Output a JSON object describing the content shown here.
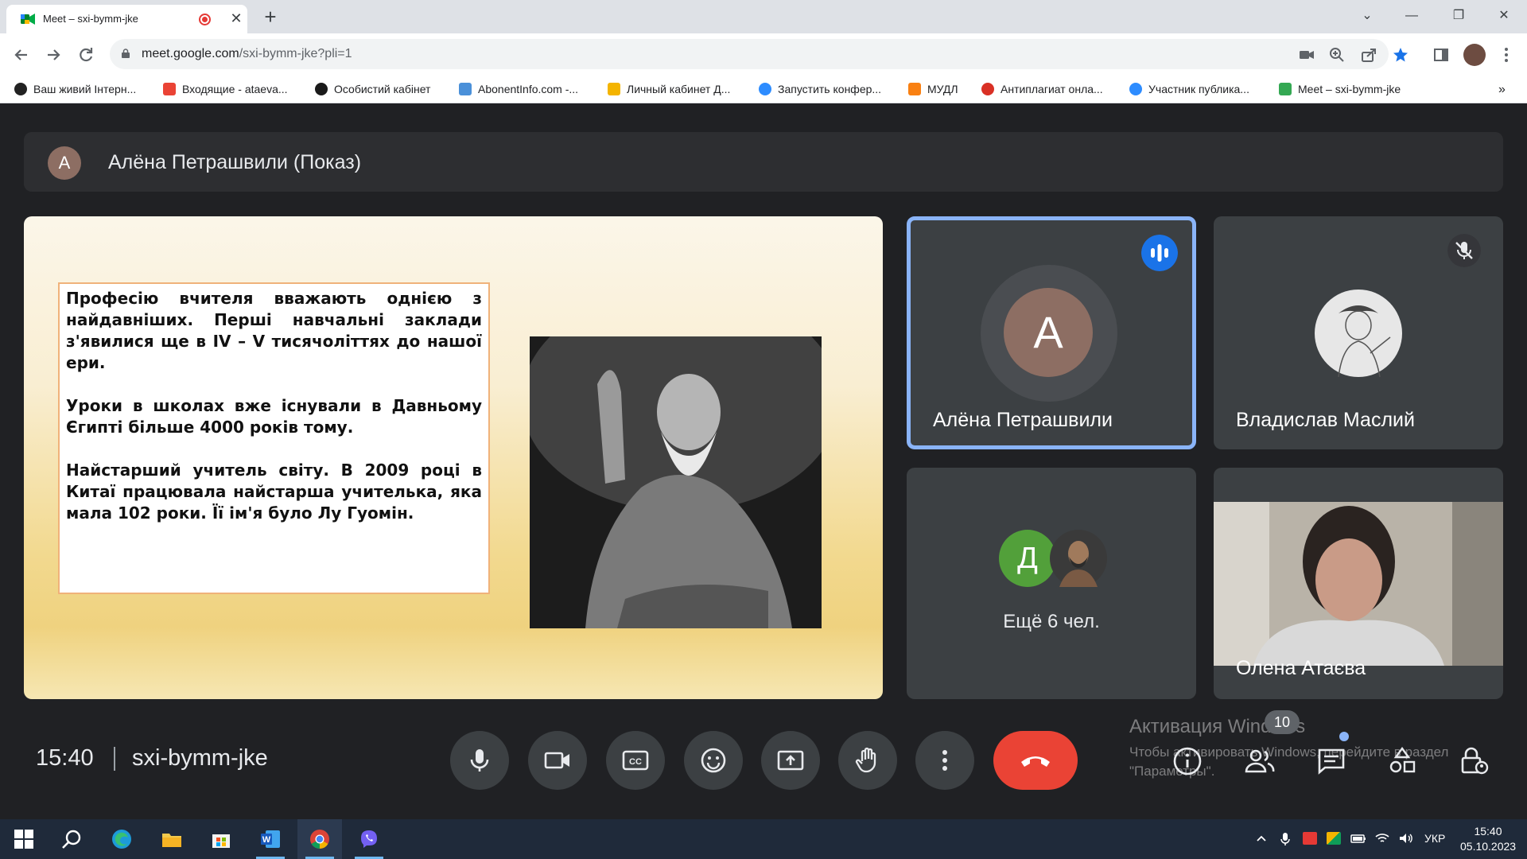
{
  "browser": {
    "tab_title": "Meet – sxi-bymm-jke",
    "url_host": "meet.google.com",
    "url_path": "/sxi-bymm-jke?pli=1",
    "new_tab": "+",
    "close_tab": "✕",
    "win_minimize": "—",
    "win_restore": "❐",
    "win_close": "✕",
    "win_tablist": "⌄"
  },
  "bookmarks": [
    {
      "label": "Ваш живий Інтерн...",
      "color": "#222222"
    },
    {
      "label": "Входящие - ataeva...",
      "color": "#ea4335"
    },
    {
      "label": "Особистий кабінет",
      "color": "#1a1a1a"
    },
    {
      "label": "AbonentInfo.com -...",
      "color": "#4a90d9"
    },
    {
      "label": "Личный кабинет Д...",
      "color": "#f4b400"
    },
    {
      "label": "Запустить конфер...",
      "color": "#2d8cff"
    },
    {
      "label": "МУДЛ",
      "color": "#f98012"
    },
    {
      "label": "Антиплагиат онла...",
      "color": "#d93025"
    },
    {
      "label": "Участник публика...",
      "color": "#2d8cff"
    },
    {
      "label": "Meet – sxi-bymm-jke",
      "color": "#34a853"
    }
  ],
  "bookmarks_more": "»",
  "meet": {
    "presenter_initial": "А",
    "presenter_label": "Алёна Петрашвили (Показ)",
    "slide": {
      "p1": "Професію вчителя вважають однією з найдавніших. Перші навчальні заклади з'явилися ще в IV – V тисячоліттях до нашої ери.",
      "p2": "Уроки в школах вже існували в Давньому Єгипті більше 4000 років тому.",
      "p3": "Найстарший учитель світу. В 2009 році в Китаї працювала найстарша учителька, яка мала 102 роки. Її ім'я було Лу Гуомін."
    },
    "tiles": {
      "alena_initial": "А",
      "alena_name": "Алёна Петрашвили",
      "vlad_name": "Владислав Маслий",
      "more_initial": "Д",
      "more_label": "Ещё 6 чел.",
      "olena_name": "Олена Атаєва"
    },
    "clock": "15:40",
    "meeting_code": "sxi-bymm-jke",
    "people_count": "10",
    "watermark_title": "Активация Windows",
    "watermark_text": "Чтобы активировать Windows, перейдите в раздел \"Параметры\"."
  },
  "taskbar": {
    "lang": "УКР",
    "time": "15:40",
    "date": "05.10.2023"
  },
  "colors": {
    "accent_blue": "#8ab4f8",
    "end_call_red": "#ea4335",
    "speaking_badge": "#1a73e8"
  }
}
